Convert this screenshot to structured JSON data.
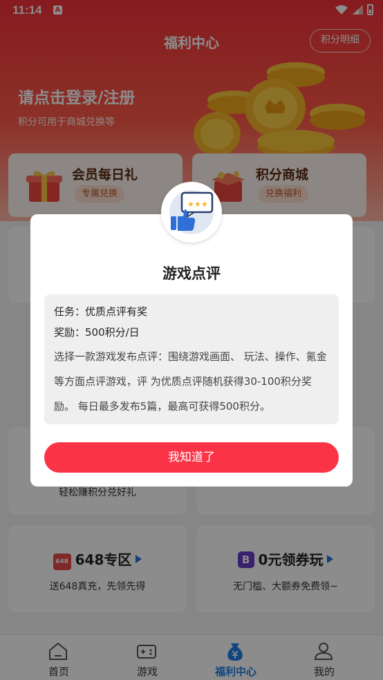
{
  "status_bar": {
    "time": "11:14",
    "notif_badge": "A"
  },
  "header": {
    "title": "福利中心",
    "detail_button": "积分明细",
    "login_text": "请点击登录/注册",
    "login_sub": "积分可用于商城兑换等"
  },
  "top_cards": [
    {
      "title": "会员每日礼",
      "tag": "专属兑换"
    },
    {
      "title": "积分商城",
      "tag": "兑换福利"
    }
  ],
  "background_snippets": {
    "left_mid": "轻松赚积分兑好礼"
  },
  "grid_cards": [
    {
      "title": "648专区",
      "subtitle": "送648真充，先领先得",
      "badge": "648"
    },
    {
      "title": "0元领券玩",
      "subtitle": "无门槛、大额券免费领~",
      "badge": "B"
    }
  ],
  "bottom_nav": [
    {
      "label": "首页",
      "icon": "home-icon"
    },
    {
      "label": "游戏",
      "icon": "gamepad-icon"
    },
    {
      "label": "福利中心",
      "icon": "money-bag-icon",
      "active": true
    },
    {
      "label": "我的",
      "icon": "user-icon"
    }
  ],
  "dialog": {
    "title": "游戏点评",
    "task": "任务：优质点评有奖",
    "reward": "奖励：500积分/日",
    "description": "选择一款游戏发布点评：围绕游戏画面、 玩法、操作、氪金等方面点评游戏，评 为优质点评随机获得30-100积分奖励。 每日最多发布5篇，最高可获得500积分。",
    "confirm_button": "我知道了"
  },
  "colors": {
    "brand_red": "#f5323a",
    "button_red": "#fb3346",
    "active_blue": "#1f7ee8"
  }
}
